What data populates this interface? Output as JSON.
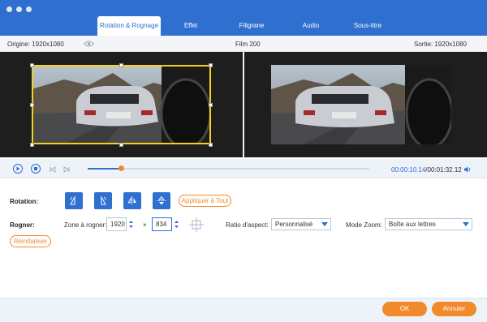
{
  "tabs": [
    {
      "label": "Rotation & Rognage",
      "active": true
    },
    {
      "label": "Effet",
      "active": false
    },
    {
      "label": "Filigrane",
      "active": false
    },
    {
      "label": "Audio",
      "active": false
    },
    {
      "label": "Sous-titre",
      "active": false
    }
  ],
  "info": {
    "origin": "Origine: 1920x1080",
    "title": "Film 200",
    "output": "Sortie: 1920x1080"
  },
  "playback": {
    "progress_fraction": 0.12,
    "current_time": "00:00:10.14",
    "total_time": "/00:01:32.12"
  },
  "rotation": {
    "label": "Rotation:",
    "buttons": [
      "rotate-left-icon",
      "rotate-right-icon",
      "flip-horizontal-icon",
      "flip-vertical-icon"
    ],
    "apply_all": "Appliquer à Tout"
  },
  "crop": {
    "label": "Rogner:",
    "zone_label": "Zone à rogner:",
    "width": "1920",
    "times": "×",
    "height": "834",
    "aspect_label": "Ratio d'aspect:",
    "aspect_value": "Personnalisé",
    "zoom_label": "Mode Zoom:",
    "zoom_value": "Boîte aux lettres",
    "reset": "Réinitialiser"
  },
  "footer": {
    "ok": "OK",
    "cancel": "Annuler"
  },
  "colors": {
    "accent": "#2e6fd0",
    "orange": "#f08a2b",
    "crop_border": "#f5d020"
  }
}
